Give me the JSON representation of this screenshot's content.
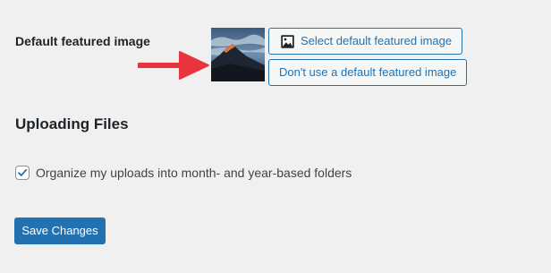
{
  "featured_image": {
    "label": "Default featured image",
    "thumbnail_icon": "mountain-landscape-thumbnail",
    "select_button_label": "Select default featured image",
    "select_button_icon": "media-image-icon",
    "no_default_button_label": "Don't use a default featured image",
    "annotation_icon": "red-arrow-icon",
    "annotation_color": "#e8343e"
  },
  "uploading": {
    "section_title": "Uploading Files",
    "organize_checkbox": {
      "label": "Organize my uploads into month- and year-based folders",
      "checked": true
    }
  },
  "actions": {
    "save_label": "Save Changes"
  },
  "colors": {
    "accent": "#2271b1",
    "background": "#f0f0f1",
    "text": "#1d2327"
  }
}
